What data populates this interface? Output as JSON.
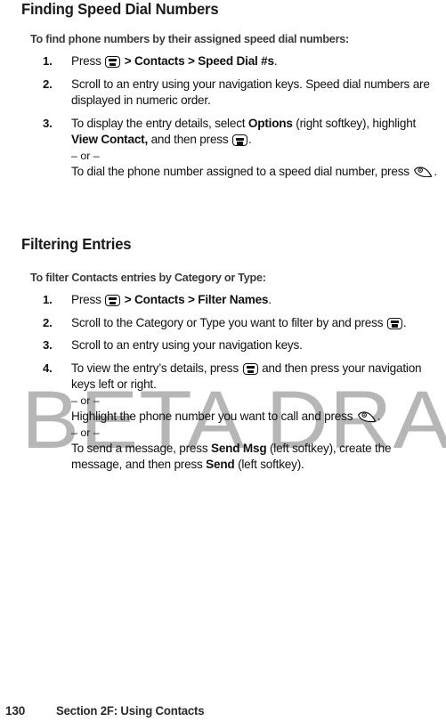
{
  "watermark": {
    "text": "BETA DRAFT",
    "color": "#b6b6b6"
  },
  "sections": [
    {
      "heading": "Finding Speed Dial Numbers",
      "lead_in": "To find phone numbers by their assigned speed dial numbers:",
      "steps": [
        {
          "number": "1.",
          "parts": [
            {
              "type": "text",
              "text": "Press "
            },
            {
              "type": "icon",
              "icon": "menu-key-icon"
            },
            {
              "type": "text",
              "text": " "
            },
            {
              "type": "bold",
              "text": "> Contacts > Speed Dial #s"
            },
            {
              "type": "text",
              "text": "."
            }
          ]
        },
        {
          "number": "2.",
          "parts": [
            {
              "type": "text",
              "text": "Scroll to an entry using your navigation keys. Speed dial numbers are displayed in numeric order."
            }
          ]
        },
        {
          "number": "3.",
          "parts": [
            {
              "type": "text",
              "text": "To display the entry details, select "
            },
            {
              "type": "bold",
              "text": "Options"
            },
            {
              "type": "text",
              "text": " (right softkey), highlight "
            },
            {
              "type": "bold",
              "text": "View Contact,"
            },
            {
              "type": "text",
              "text": " and then press "
            },
            {
              "type": "icon",
              "icon": "menu-key-icon"
            },
            {
              "type": "text",
              "text": "."
            },
            {
              "type": "or",
              "text": "– or –"
            },
            {
              "type": "line",
              "text": "To dial the phone number assigned to a speed dial number, press "
            },
            {
              "type": "icon",
              "icon": "talk-key-icon"
            },
            {
              "type": "text",
              "text": "."
            }
          ]
        }
      ]
    },
    {
      "heading": "Filtering Entries",
      "lead_in": "To filter Contacts entries by Category or Type:",
      "steps": [
        {
          "number": "1.",
          "parts": [
            {
              "type": "text",
              "text": "Press "
            },
            {
              "type": "icon",
              "icon": "menu-key-icon"
            },
            {
              "type": "text",
              "text": " "
            },
            {
              "type": "bold",
              "text": "> Contacts > Filter Names"
            },
            {
              "type": "text",
              "text": "."
            }
          ]
        },
        {
          "number": "2.",
          "parts": [
            {
              "type": "text",
              "text": "Scroll to the Category or Type you want to filter by and press "
            },
            {
              "type": "icon",
              "icon": "menu-key-icon"
            },
            {
              "type": "text",
              "text": "."
            }
          ]
        },
        {
          "number": "3.",
          "parts": [
            {
              "type": "text",
              "text": "Scroll to an entry using your navigation keys."
            }
          ]
        },
        {
          "number": "4.",
          "parts": [
            {
              "type": "text",
              "text": "To view the entry’s details, press "
            },
            {
              "type": "icon",
              "icon": "menu-key-icon"
            },
            {
              "type": "text",
              "text": " and then press your navigation keys left or right."
            },
            {
              "type": "or",
              "text": "– or –"
            },
            {
              "type": "line",
              "text": "Highlight the phone number you want to call and press "
            },
            {
              "type": "icon",
              "icon": "talk-key-icon"
            },
            {
              "type": "text",
              "text": "."
            },
            {
              "type": "or",
              "text": "– or –"
            },
            {
              "type": "line",
              "text": "To send a message, press "
            },
            {
              "type": "bold",
              "text": "Send Msg"
            },
            {
              "type": "text",
              "text": " (left softkey), create the message, and then press "
            },
            {
              "type": "bold",
              "text": "Send"
            },
            {
              "type": "text",
              "text": " (left softkey)."
            }
          ]
        }
      ]
    }
  ],
  "footer": {
    "page_number": "130",
    "section_label": "Section 2F: Using Contacts"
  }
}
